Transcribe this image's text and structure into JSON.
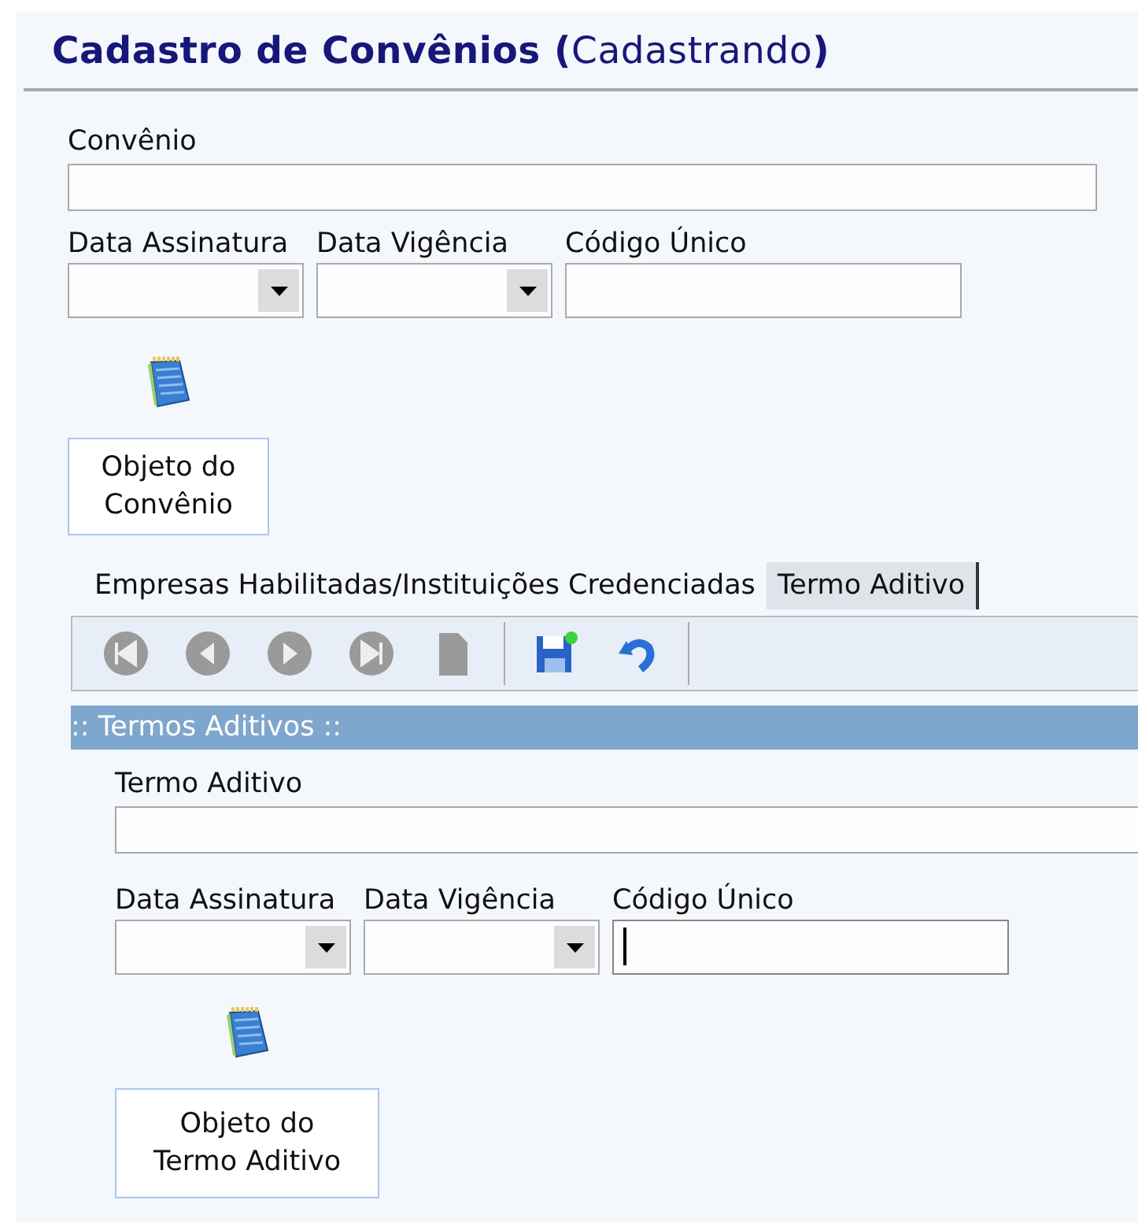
{
  "title": "**Cadastro de Convênios (**Cadastrando**)**",
  "main_form": {
    "name_field": {
      "label": "Convênio"
    },
    "fields": [
      {
        "label": "Data Assinatura",
        "kind": "dropdown",
        "focused": false
      },
      {
        "label": "Data Vigência",
        "kind": "dropdown",
        "focused": false
      },
      {
        "label": "Código Único",
        "kind": "text",
        "focused": false
      }
    ],
    "object_button": {
      "label": "Objeto do\nConvênio"
    }
  },
  "tabs": [
    {
      "label": "Empresas Habilitadas/Instituições Credenciadas",
      "selected": false
    },
    {
      "label": "Termo Aditivo",
      "selected": true
    }
  ],
  "toolbar": [
    {
      "kind": "first",
      "disabled": true
    },
    {
      "kind": "previous",
      "disabled": true
    },
    {
      "kind": "next",
      "disabled": true
    },
    {
      "kind": "last",
      "disabled": true
    },
    {
      "kind": "new",
      "disabled": true
    },
    {
      "kind": "separator"
    },
    {
      "kind": "save",
      "disabled": false
    },
    {
      "kind": "undo",
      "disabled": false
    },
    {
      "kind": "separator"
    }
  ],
  "section_header": ":: Termos Aditivos ::",
  "sub_form": {
    "name_field": {
      "label": "Termo Aditivo"
    },
    "fields": [
      {
        "label": "Data Assinatura",
        "kind": "dropdown",
        "focused": false
      },
      {
        "label": "Data Vigência",
        "kind": "dropdown",
        "focused": false
      },
      {
        "label": "Código Único",
        "kind": "text",
        "focused": true
      }
    ],
    "object_button": {
      "label": "Objeto do\nTermo Aditivo"
    }
  }
}
